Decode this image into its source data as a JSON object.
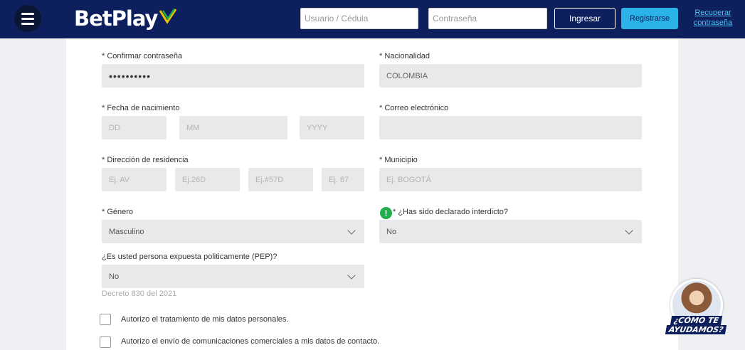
{
  "header": {
    "brand": "BetPlay",
    "user_placeholder": "Usuario / Cédula",
    "password_placeholder": "Contraseña",
    "login_label": "Ingresar",
    "register_label": "Registrarse",
    "recover_label": "Recuperar contraseña"
  },
  "form": {
    "confirm_password": {
      "label": "* Confirmar contraseña",
      "value": "••••••••••"
    },
    "nationality": {
      "label": "* Nacionalidad",
      "value": "COLOMBIA"
    },
    "birth_date": {
      "label": "* Fecha de nacimiento",
      "day": "DD",
      "month": "MM",
      "year": "YYYY"
    },
    "email": {
      "label": "* Correo electrónico",
      "value": ""
    },
    "address": {
      "label": "* Dirección de residencia",
      "part1": "Ej. AV",
      "part2": "Ej.26D",
      "part3": "Ej.#57D",
      "part4": "Ej. 87"
    },
    "municipality": {
      "label": "* Municipio",
      "placeholder": "Ej. BOGOTÁ"
    },
    "gender": {
      "label": "* Género",
      "value": "Masculino"
    },
    "interdicted": {
      "label": "* ¿Has sido declarado interdicto?",
      "value": "No"
    },
    "pep": {
      "label": "¿Es usted persona expuesta politicamente (PEP)?",
      "value": "No",
      "hint": "Decreto 830 del 2021"
    },
    "consent_data": "Autorizo el tratamiento de mis datos personales.",
    "consent_comms": "Autorizo el envío de comunicaciones comerciales a mis datos de contacto."
  },
  "help": {
    "line1": "¿CÓMO TE",
    "line2": "AYUDAMOS?"
  },
  "colors": {
    "header_bg": "#0d1f5c",
    "accent": "#2bb3e8",
    "info_green": "#1fae4b"
  }
}
